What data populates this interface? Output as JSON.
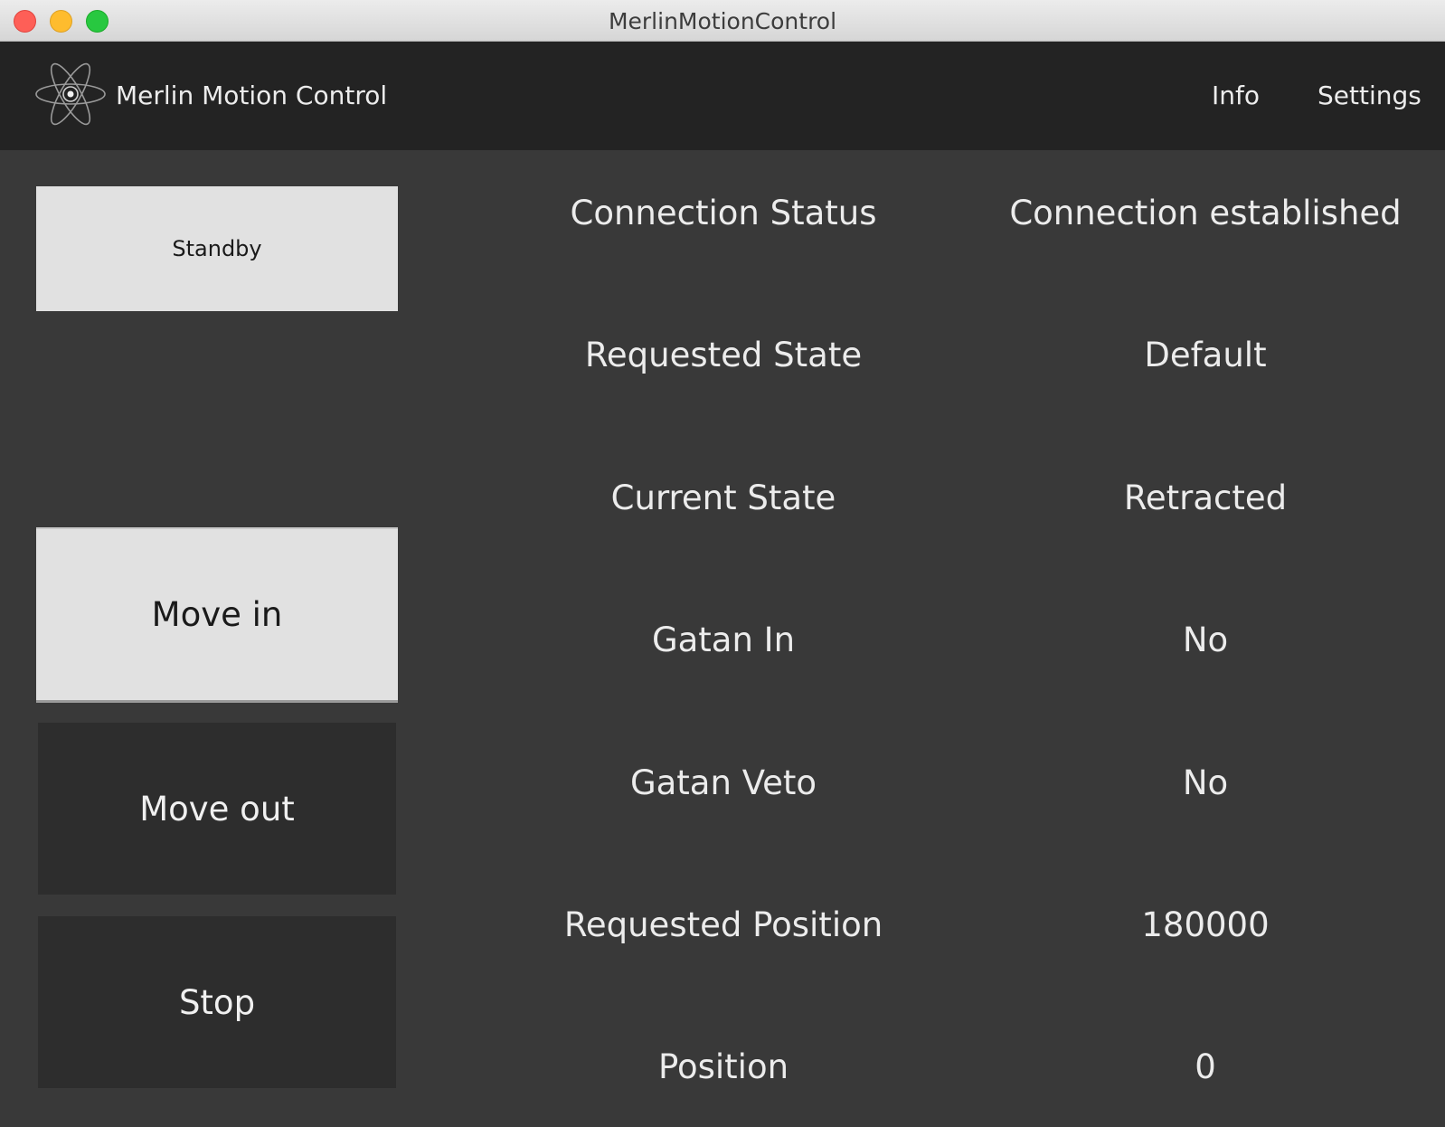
{
  "window": {
    "title": "MerlinMotionControl"
  },
  "appbar": {
    "logo_icon": "atom-icon",
    "title": "Merlin Motion Control",
    "nav": {
      "info": "Info",
      "settings": "Settings"
    }
  },
  "controls": {
    "standby": "Standby",
    "move_in": "Move in",
    "move_out": "Move out",
    "stop": "Stop"
  },
  "status": [
    {
      "label": "Connection Status",
      "value": "Connection established"
    },
    {
      "label": "Requested State",
      "value": "Default"
    },
    {
      "label": "Current State",
      "value": "Retracted"
    },
    {
      "label": "Gatan In",
      "value": "No"
    },
    {
      "label": "Gatan Veto",
      "value": "No"
    },
    {
      "label": "Requested Position",
      "value": "180000"
    },
    {
      "label": "Position",
      "value": "0"
    }
  ],
  "colors": {
    "background": "#393939",
    "header": "#232323",
    "button_light": "#e1e1e1",
    "button_dark": "#2d2d2d",
    "text": "#ececec"
  }
}
